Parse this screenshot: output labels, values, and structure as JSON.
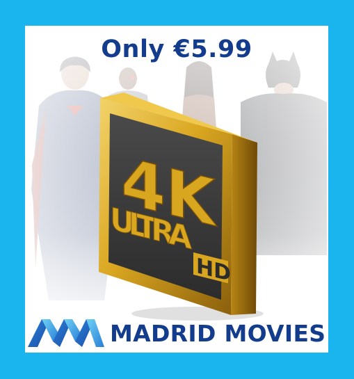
{
  "promo": {
    "price_text": "Only €5.99"
  },
  "badge": {
    "label_4k": "4K",
    "label_ultra": "ULTRA",
    "label_hd": "HD"
  },
  "brand": {
    "name": "MADRID MOVIES"
  },
  "colors": {
    "background": "#1ab4ee",
    "card": "#ffffff",
    "brand_blue": "#133c8c",
    "gold": "#d9a620",
    "badge_face": "#3a3a3a"
  },
  "icons": {
    "logo": "madrid-movies-mm-logo-icon"
  }
}
